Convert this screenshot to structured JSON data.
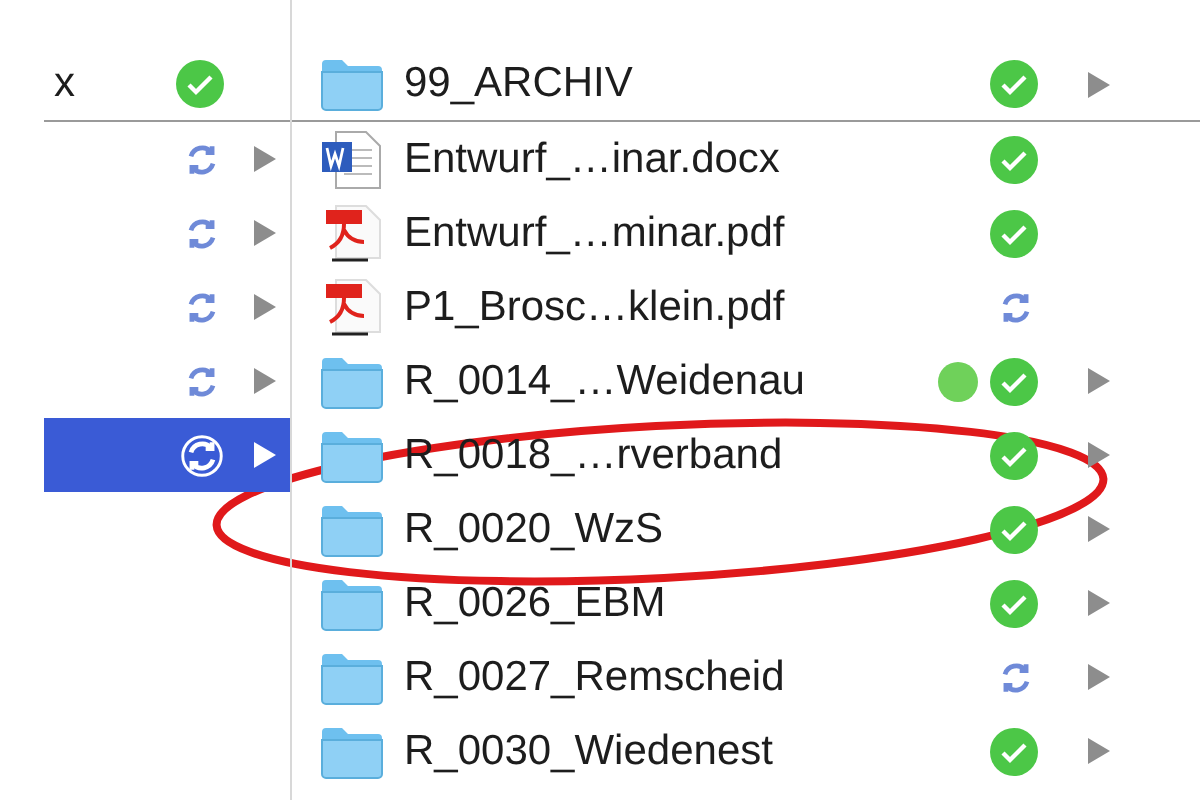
{
  "parent_column": {
    "items": [
      {
        "label": "x",
        "synced": true,
        "has_children": false,
        "selected": false
      },
      {
        "synced": false,
        "has_children": true,
        "selected": false
      },
      {
        "synced": false,
        "has_children": true,
        "selected": false
      },
      {
        "synced": false,
        "has_children": true,
        "selected": false
      },
      {
        "synced": false,
        "has_children": true,
        "selected": false
      },
      {
        "synced": false,
        "has_children": true,
        "selected": true
      }
    ]
  },
  "file_column": {
    "items": [
      {
        "name": "99_ARCHIV",
        "kind": "folder",
        "synced": true,
        "has_children": true
      },
      {
        "name": "Entwurf_…inar.docx",
        "kind": "word",
        "synced": true,
        "has_children": false
      },
      {
        "name": "Entwurf_…minar.pdf",
        "kind": "pdf",
        "synced": true,
        "has_children": false
      },
      {
        "name": "P1_Brosc…klein.pdf",
        "kind": "pdf",
        "synced": false,
        "has_children": false
      },
      {
        "name": "R_0014_…Weidenau",
        "kind": "folder",
        "synced": true,
        "has_children": true,
        "color": "#6fd15a"
      },
      {
        "name": "R_0018_…rverband",
        "kind": "folder",
        "synced": true,
        "has_children": true
      },
      {
        "name": "R_0020_WzS",
        "kind": "folder",
        "synced": true,
        "has_children": true
      },
      {
        "name": "R_0026_EBM",
        "kind": "folder",
        "synced": true,
        "has_children": true
      },
      {
        "name": "R_0027_Remscheid",
        "kind": "folder",
        "synced": false,
        "has_children": true
      },
      {
        "name": "R_0030_Wiedenest",
        "kind": "folder",
        "synced": true,
        "has_children": true
      }
    ]
  },
  "annotation": {
    "kind": "ellipse",
    "color": "#e0191b"
  }
}
